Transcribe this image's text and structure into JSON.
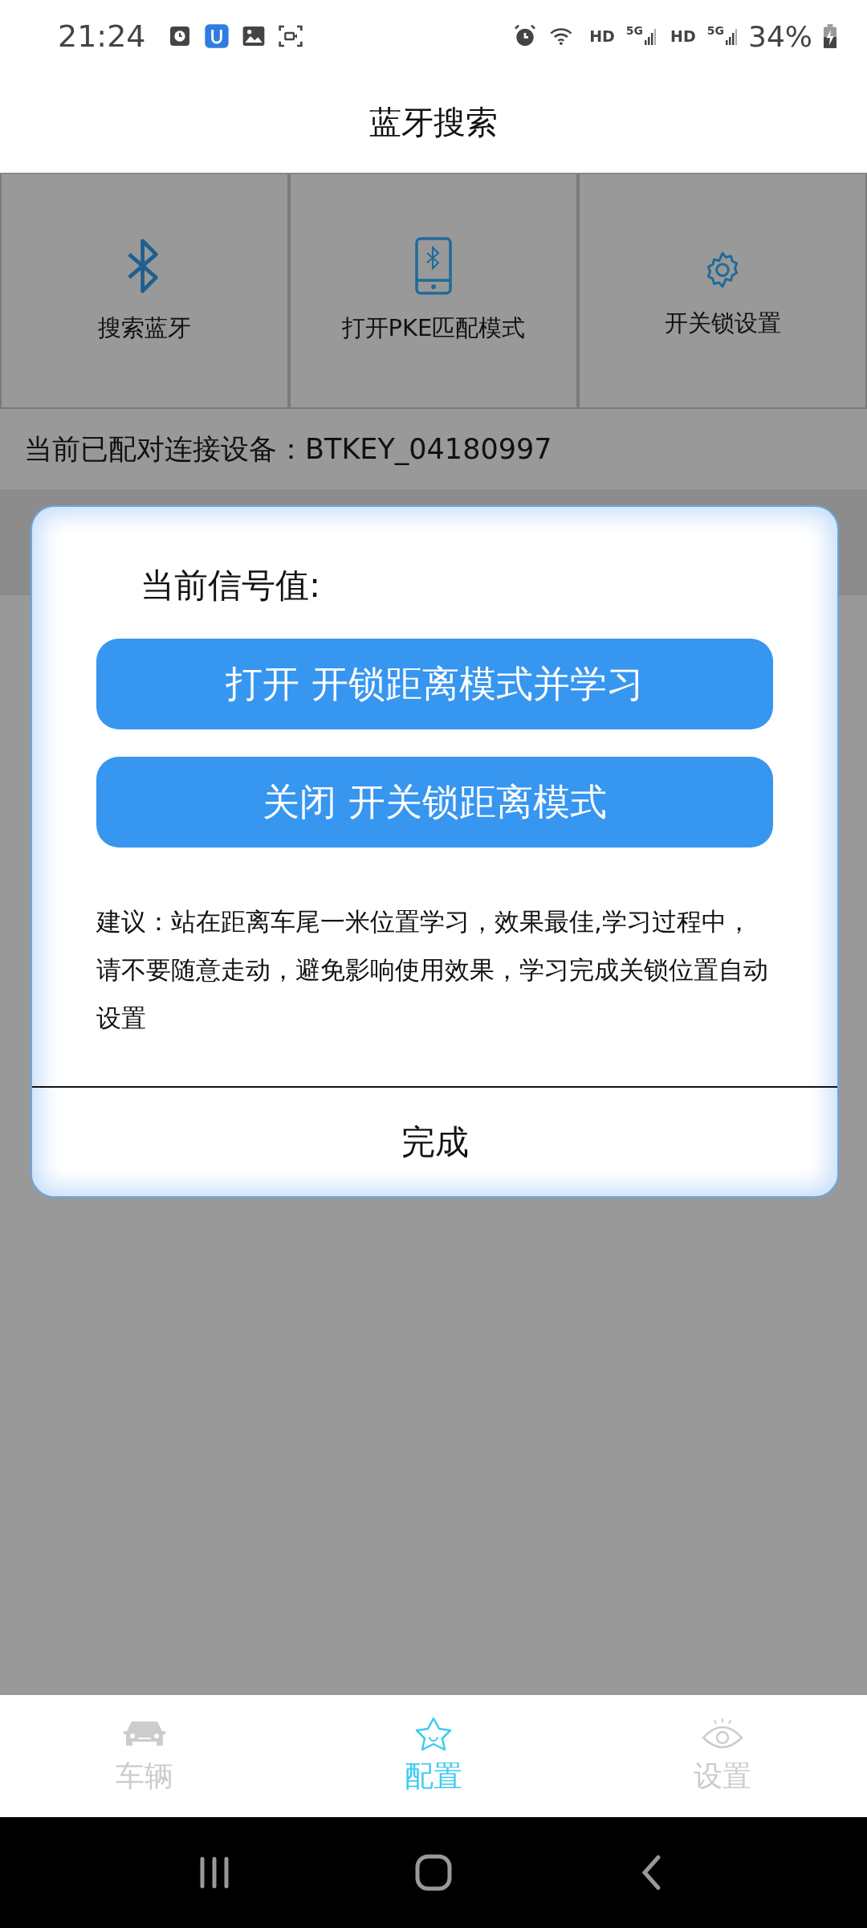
{
  "status_bar": {
    "time": "21:24",
    "networks": [
      {
        "hd": "HD",
        "gen": "5G"
      },
      {
        "hd": "HD",
        "gen": "5G"
      }
    ],
    "battery": "34%"
  },
  "header": {
    "title": "蓝牙搜索"
  },
  "actions": [
    {
      "kind": "bluetooth",
      "label": "搜索蓝牙"
    },
    {
      "kind": "phone",
      "label": "打开PKE匹配模式"
    },
    {
      "kind": "gear",
      "label": "开关锁设置"
    }
  ],
  "paired_device": "当前已配对连接设备：BTKEY_04180997",
  "dialog": {
    "signal_label": "当前信号值:",
    "buttons": [
      "打开 开锁距离模式并学习",
      "关闭 开关锁距离模式"
    ],
    "advice": "建议：站在距离车尾一米位置学习，效果最佳,学习过程中，请不要随意走动，避免影响使用效果，学习完成关锁位置自动设置",
    "confirm": "完成"
  },
  "tab_bar": [
    {
      "kind": "car",
      "label": "车辆",
      "selected": false
    },
    {
      "kind": "star",
      "label": "配置",
      "selected": true
    },
    {
      "kind": "eye",
      "label": "设置",
      "selected": false
    }
  ]
}
